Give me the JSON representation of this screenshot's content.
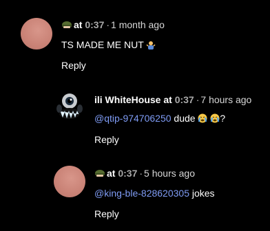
{
  "comments": [
    {
      "author": "at",
      "author_icon": "helmet-icon",
      "timestamp": "0:37",
      "separator": "·",
      "relative_time": "1 month ago",
      "text": "TS MADE ME NUT",
      "emoji": "man-shrugging-emoji",
      "reply_label": "Reply"
    },
    {
      "author": "ili WhiteHouse at",
      "timestamp": "0:37",
      "separator": "·",
      "relative_time": "7 hours ago",
      "mention": "@qtip-974706250",
      "text": " dude ",
      "emoji": "crying-face-emoji",
      "trailing": "?",
      "reply_label": "Reply"
    },
    {
      "author": "at",
      "author_icon": "helmet-icon",
      "timestamp": "0:37",
      "separator": "·",
      "relative_time": "5 hours ago",
      "mention": "@king-ble-828620305",
      "text": " jokes",
      "reply_label": "Reply"
    }
  ],
  "colors": {
    "background": "#000000",
    "mention": "#7f9cf5",
    "avatar_pink": "#c98276"
  }
}
